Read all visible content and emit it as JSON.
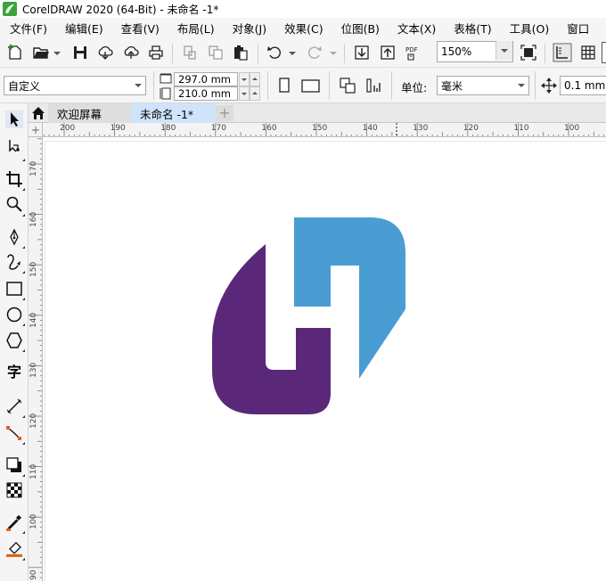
{
  "window": {
    "title": "CorelDRAW 2020 (64-Bit) - 未命名 -1*"
  },
  "menu": [
    "文件(F)",
    "编辑(E)",
    "查看(V)",
    "布局(L)",
    "对象(J)",
    "效果(C)",
    "位图(B)",
    "文本(X)",
    "表格(T)",
    "工具(O)",
    "窗口"
  ],
  "toolbar": {
    "zoom_value": "150%"
  },
  "property_bar": {
    "page_size_preset": "自定义",
    "page_width": "297.0 mm",
    "page_height": "210.0 mm",
    "units_label": "单位:",
    "units_value": "毫米",
    "nudge_value": "0.1 mm"
  },
  "tabs": {
    "welcome": "欢迎屏幕",
    "document": "未命名 -1*",
    "add": "+"
  },
  "toolbox": {
    "text_tool_glyph": "字"
  },
  "ruler_top": [
    "200",
    "190",
    "180",
    "170",
    "160",
    "150",
    "140",
    "130",
    "120",
    "110",
    "100"
  ],
  "ruler_left": [
    "170",
    "160",
    "150",
    "140",
    "130",
    "120",
    "110",
    "100",
    "90"
  ],
  "colors": {
    "logo_purple": "#5b2879",
    "logo_blue": "#4a9dd3",
    "accent_tab": "#cfe4fb"
  },
  "icons": {
    "toolbar": [
      "new-document-icon",
      "open-folder-icon",
      "save-icon",
      "cloud-download-icon",
      "cloud-upload-icon",
      "print-icon",
      "cut-icon",
      "copy-icon",
      "paste-icon",
      "undo-icon",
      "redo-icon",
      "import-icon",
      "export-icon",
      "pdf-icon",
      "full-screen-icon",
      "show-rulers-icon",
      "show-grid-icon"
    ],
    "toolbox": [
      "pick-tool-icon",
      "shape-tool-icon",
      "crop-tool-icon",
      "zoom-tool-icon",
      "pen-tool-icon",
      "freehand-tool-icon",
      "rectangle-tool-icon",
      "ellipse-tool-icon",
      "polygon-tool-icon",
      "text-tool-icon",
      "dimension-tool-icon",
      "connector-tool-icon",
      "drop-shadow-tool-icon",
      "transparency-tool-icon",
      "eyedropper-tool-icon",
      "interactive-fill-tool-icon"
    ]
  }
}
